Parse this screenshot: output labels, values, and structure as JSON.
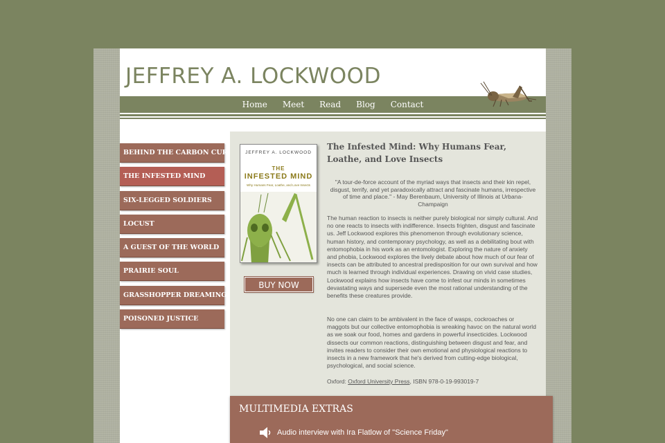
{
  "site": {
    "title": "JEFFREY A. LOCKWOOD"
  },
  "nav": [
    "Home",
    "Meet",
    "Read",
    "Blog",
    "Contact"
  ],
  "sidebar": [
    {
      "label": "BEHIND THE CARBON CURTAIN"
    },
    {
      "label": "THE INFESTED MIND",
      "active": true
    },
    {
      "label": "SIX-LEGGED SOLDIERS"
    },
    {
      "label": "LOCUST"
    },
    {
      "label": "A GUEST OF THE WORLD"
    },
    {
      "label": "PRAIRIE SOUL"
    },
    {
      "label": "GRASSHOPPER DREAMING"
    },
    {
      "label": "POISONED JUSTICE"
    }
  ],
  "book": {
    "cover_author": "JEFFREY A. LOCKWOOD",
    "cover_title_line1": "THE",
    "cover_title_line2": "INFESTED MIND",
    "cover_subtitle": "Why Humans Fear, Loathe, and Love Insects",
    "buy_label": "BUY NOW",
    "title": "The Infested Mind: Why Humans Fear, Loathe, and Love Insects",
    "quote": "\"A tour-de-force account of the myriad ways that insects and their kin repel, disgust, terrify, and yet paradoxically attract and fascinate humans, irrespective of time and place.\" - May Berenbaum, University of Illinois at Urbana-Champaign",
    "paragraph1": "The human reaction to insects is neither purely biological nor simply cultural. And no one reacts to insects with indifference. Insects frighten, disgust and fascinate us. Jeff Lockwood explores this phenomenon through evolutionary science, human history, and contemporary psychology, as well as a debilitating bout with entomophobia in his work as an entomologist. Exploring the nature of anxiety and phobia, Lockwood explores the lively debate about how much of our fear of insects can be attributed to ancestral predisposition for our own survival and how much is learned through individual experiences. Drawing on vivid case studies, Lockwood explains how insects have come to infest our minds in sometimes devastating ways and supersede even the most rational understanding of the benefits these creatures provide.",
    "paragraph2": "No one can claim to be ambivalent in the face of wasps, cockroaches or maggots but our collective entomophobia is wreaking havoc on the natural world as we soak our food, homes and gardens in powerful insecticides. Lockwood dissects our common reactions, distinguishing between disgust and fear, and invites readers to consider their own emotional and physiological reactions to insects in a new framework that he's derived from cutting-edge biological, psychological, and social science.",
    "pub_prefix": "Oxford: ",
    "pub_link": "Oxford University Press",
    "pub_suffix": ", ISBN 978-0-19-993019-7"
  },
  "multimedia": {
    "title": "MULTIMEDIA EXTRAS",
    "items": [
      {
        "icon": "speaker-icon",
        "label": "Audio interview with Ira Flatlow of \"Science Friday\""
      }
    ]
  },
  "colors": {
    "olive": "#7b8460",
    "brown": "#9c6a5a",
    "active": "#b45e55",
    "panel": "#e4e5dc"
  }
}
